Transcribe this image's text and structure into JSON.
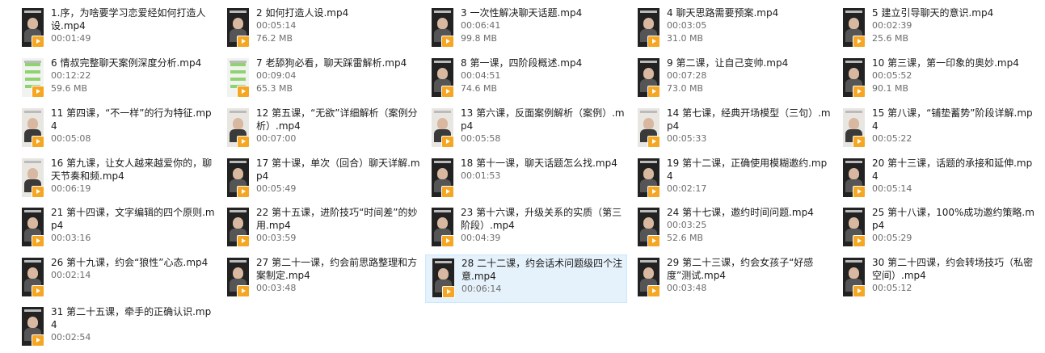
{
  "files": [
    {
      "name": "1.序，为啥要学习恋爱经如何打造人设.mp4",
      "duration": "00:01:49",
      "size": "",
      "thumb": "dark"
    },
    {
      "name": "2 如何打造人设.mp4",
      "duration": "00:05:14",
      "size": "76.2 MB",
      "thumb": "dark"
    },
    {
      "name": "3 一次性解决聊天话题.mp4",
      "duration": "00:06:41",
      "size": "99.8 MB",
      "thumb": "dark"
    },
    {
      "name": "4 聊天思路需要预案.mp4",
      "duration": "00:03:05",
      "size": "31.0 MB",
      "thumb": "dark"
    },
    {
      "name": "5 建立引导聊天的意识.mp4",
      "duration": "00:02:39",
      "size": "25.6 MB",
      "thumb": "dark"
    },
    {
      "name": "6 情叔完整聊天案例深度分析.mp4",
      "duration": "00:12:22",
      "size": "59.6 MB",
      "thumb": "screen"
    },
    {
      "name": "7 老舔狗必看，聊天踩雷解析.mp4",
      "duration": "00:09:04",
      "size": "65.3 MB",
      "thumb": "screen"
    },
    {
      "name": "8 第一课，四阶段概述.mp4",
      "duration": "00:04:51",
      "size": "74.6 MB",
      "thumb": "dark"
    },
    {
      "name": "9 第二课，让自己变帅.mp4",
      "duration": "00:07:28",
      "size": "73.0 MB",
      "thumb": "dark"
    },
    {
      "name": "10 第三课，第一印象的奥妙.mp4",
      "duration": "00:05:52",
      "size": "90.1 MB",
      "thumb": "dark"
    },
    {
      "name": "11 第四课，“不一样”的行为特征.mp4",
      "duration": "00:05:08",
      "size": "",
      "thumb": "bright"
    },
    {
      "name": "12 第五课，“无欲”详细解析（案例分析）.mp4",
      "duration": "00:07:00",
      "size": "",
      "thumb": "bright"
    },
    {
      "name": "13 第六课，反面案例解析（案例）.mp4",
      "duration": "00:05:58",
      "size": "",
      "thumb": "bright"
    },
    {
      "name": "14 第七课，经典开场模型（三句）.mp4",
      "duration": "00:05:33",
      "size": "",
      "thumb": "bright"
    },
    {
      "name": "15 第八课，“铺垫蓄势”阶段详解.mp4",
      "duration": "00:05:22",
      "size": "",
      "thumb": "bright"
    },
    {
      "name": "16 第九课，让女人越来越爱你的，聊天节奏和频.mp4",
      "duration": "00:06:19",
      "size": "",
      "thumb": "bright"
    },
    {
      "name": "17 第十课，单次（回合）聊天详解.mp4",
      "duration": "00:05:49",
      "size": "",
      "thumb": "dark"
    },
    {
      "name": "18 第十一课，聊天话题怎么找.mp4",
      "duration": "00:01:53",
      "size": "",
      "thumb": "dark"
    },
    {
      "name": "19 第十二课，正确使用模糊邀约.mp4",
      "duration": "00:02:17",
      "size": "",
      "thumb": "dark"
    },
    {
      "name": "20 第十三课，话题的承接和延伸.mp4",
      "duration": "00:05:14",
      "size": "",
      "thumb": "dark"
    },
    {
      "name": "21 第十四课，文字编辑的四个原则.mp4",
      "duration": "00:03:16",
      "size": "",
      "thumb": "dark"
    },
    {
      "name": "22 第十五课，进阶技巧“时间差”的妙用.mp4",
      "duration": "00:03:59",
      "size": "",
      "thumb": "dark"
    },
    {
      "name": "23 第十六课，升级关系的实质（第三阶段）.mp4",
      "duration": "00:04:39",
      "size": "",
      "thumb": "dark"
    },
    {
      "name": "24 第十七课，邀约时间问题.mp4",
      "duration": "00:03:25",
      "size": "52.6 MB",
      "thumb": "dark"
    },
    {
      "name": "25 第十八课，100%成功邀约策略.mp4",
      "duration": "00:05:29",
      "size": "",
      "thumb": "dark"
    },
    {
      "name": "26 第十九课，约会“狼性”心态.mp4",
      "duration": "00:02:14",
      "size": "",
      "thumb": "dark"
    },
    {
      "name": "27 第二十一课，约会前思路整理和方案制定.mp4",
      "duration": "00:03:48",
      "size": "",
      "thumb": "dark"
    },
    {
      "name": "28 二十二课，约会话术问题级四个注意.mp4",
      "duration": "00:06:14",
      "size": "",
      "thumb": "dark"
    },
    {
      "name": "29 第二十三课，约会女孩子“好感度”测试.mp4",
      "duration": "00:03:48",
      "size": "",
      "thumb": "dark"
    },
    {
      "name": "30 第二十四课，约会转场技巧（私密空间）.mp4",
      "duration": "00:05:12",
      "size": "",
      "thumb": "dark"
    },
    {
      "name": "31 第二十五课，牵手的正确认识.mp4",
      "duration": "00:02:54",
      "size": "",
      "thumb": "dark"
    }
  ],
  "selected_index": 27
}
